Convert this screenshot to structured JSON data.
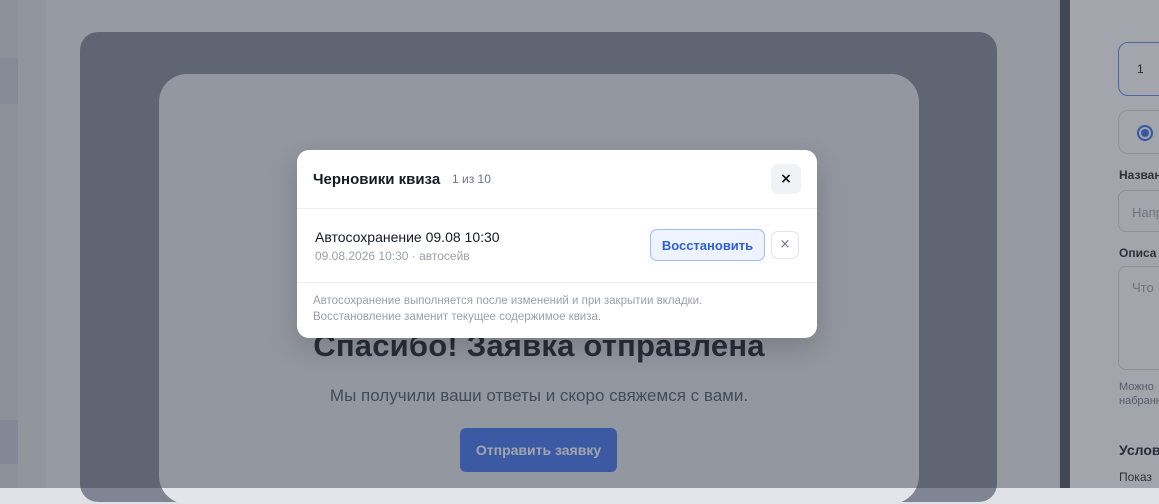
{
  "background": {
    "thanks_title": "Спасибо! Заявка отправлена",
    "thanks_subtitle": "Мы получили ваши ответы и скоро свяжемся с вами.",
    "submit_button": "Отправить заявку"
  },
  "right_panel": {
    "number_value": "1",
    "name_label": "Назван",
    "name_placeholder": "Напр",
    "description_label": "Описа",
    "description_placeholder": "Что",
    "note_line1": "Можно",
    "note_line2": "набранн",
    "section_title": "Условн",
    "show_label": "Показ"
  },
  "modal": {
    "title": "Черновики квиза",
    "count": "1 из 10",
    "close_icon": "×",
    "drafts": [
      {
        "name": "Автосохранение 09.08 10:30",
        "meta": "09.08.2026 10:30 · автосейв",
        "restore_label": "Восстановить",
        "delete_icon": "×"
      }
    ],
    "footer_line1": "Автосохранение выполняется после изменений и при закрытии вкладки.",
    "footer_line2": "Восстановление заменит текущее содержимое квиза."
  },
  "colors": {
    "accent": "#3b6ff0",
    "restore_text": "#2f5fd4",
    "overlay": "rgba(60,66,80,0.48)"
  }
}
